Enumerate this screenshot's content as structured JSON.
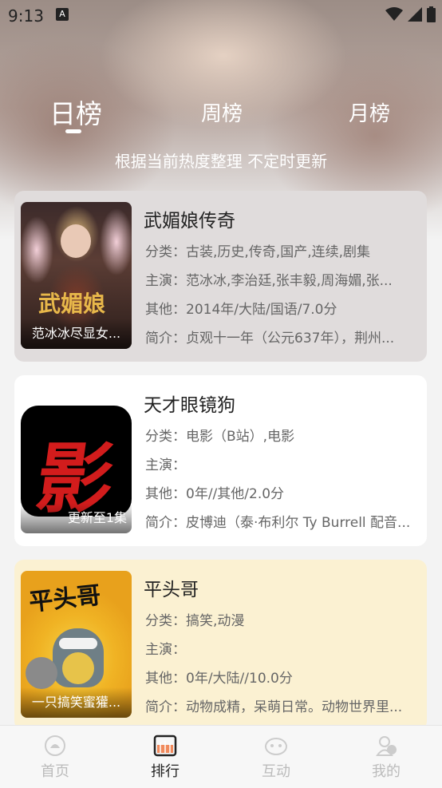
{
  "status_bar": {
    "time": "9:13",
    "badge": "A"
  },
  "tabs": [
    {
      "label": "日榜",
      "active": true
    },
    {
      "label": "周榜",
      "active": false
    },
    {
      "label": "月榜",
      "active": false
    }
  ],
  "subtitle": "根据当前热度整理 不定时更新",
  "items": [
    {
      "title": "武媚娘传奇",
      "poster_caption": "范冰冰尽显女...",
      "category": "分类：古装,历史,传奇,国产,连续,剧集",
      "cast": "主演：范冰冰,李治廷,张丰毅,周海媚,张...",
      "other": "其他：2014年/大陆/国语/7.0分",
      "intro": "简介：贞观十一年（公元637年），荆州...",
      "background": "#e0dcdc"
    },
    {
      "title": "天才眼镜狗",
      "poster_caption": "更新至1集",
      "poster_glyph": "影",
      "category": "分类：电影（B站）,电影",
      "cast": "主演：",
      "other": "其他：0年//其他/2.0分",
      "intro": "简介：皮博迪（泰·布利尔 Ty Burrell 配音...",
      "background": "#ffffff"
    },
    {
      "title": "平头哥",
      "poster_caption": "一只搞笑蜜獾...",
      "poster_logo": "平头哥",
      "category": "分类：搞笑,动漫",
      "cast": "主演：",
      "other": "其他：0年/大陆//10.0分",
      "intro": "简介：动物成精，呆萌日常。动物世界里...",
      "background": "#fbf1d2"
    }
  ],
  "bottom_nav": [
    {
      "label": "首页",
      "icon": "home-icon",
      "active": false
    },
    {
      "label": "排行",
      "icon": "ranking-icon",
      "active": true
    },
    {
      "label": "互动",
      "icon": "interact-icon",
      "active": false
    },
    {
      "label": "我的",
      "icon": "profile-icon",
      "active": false
    }
  ],
  "colors": {
    "accent": "#ffffff",
    "nav_active": "#222222",
    "nav_inactive": "#bbbbbb"
  }
}
